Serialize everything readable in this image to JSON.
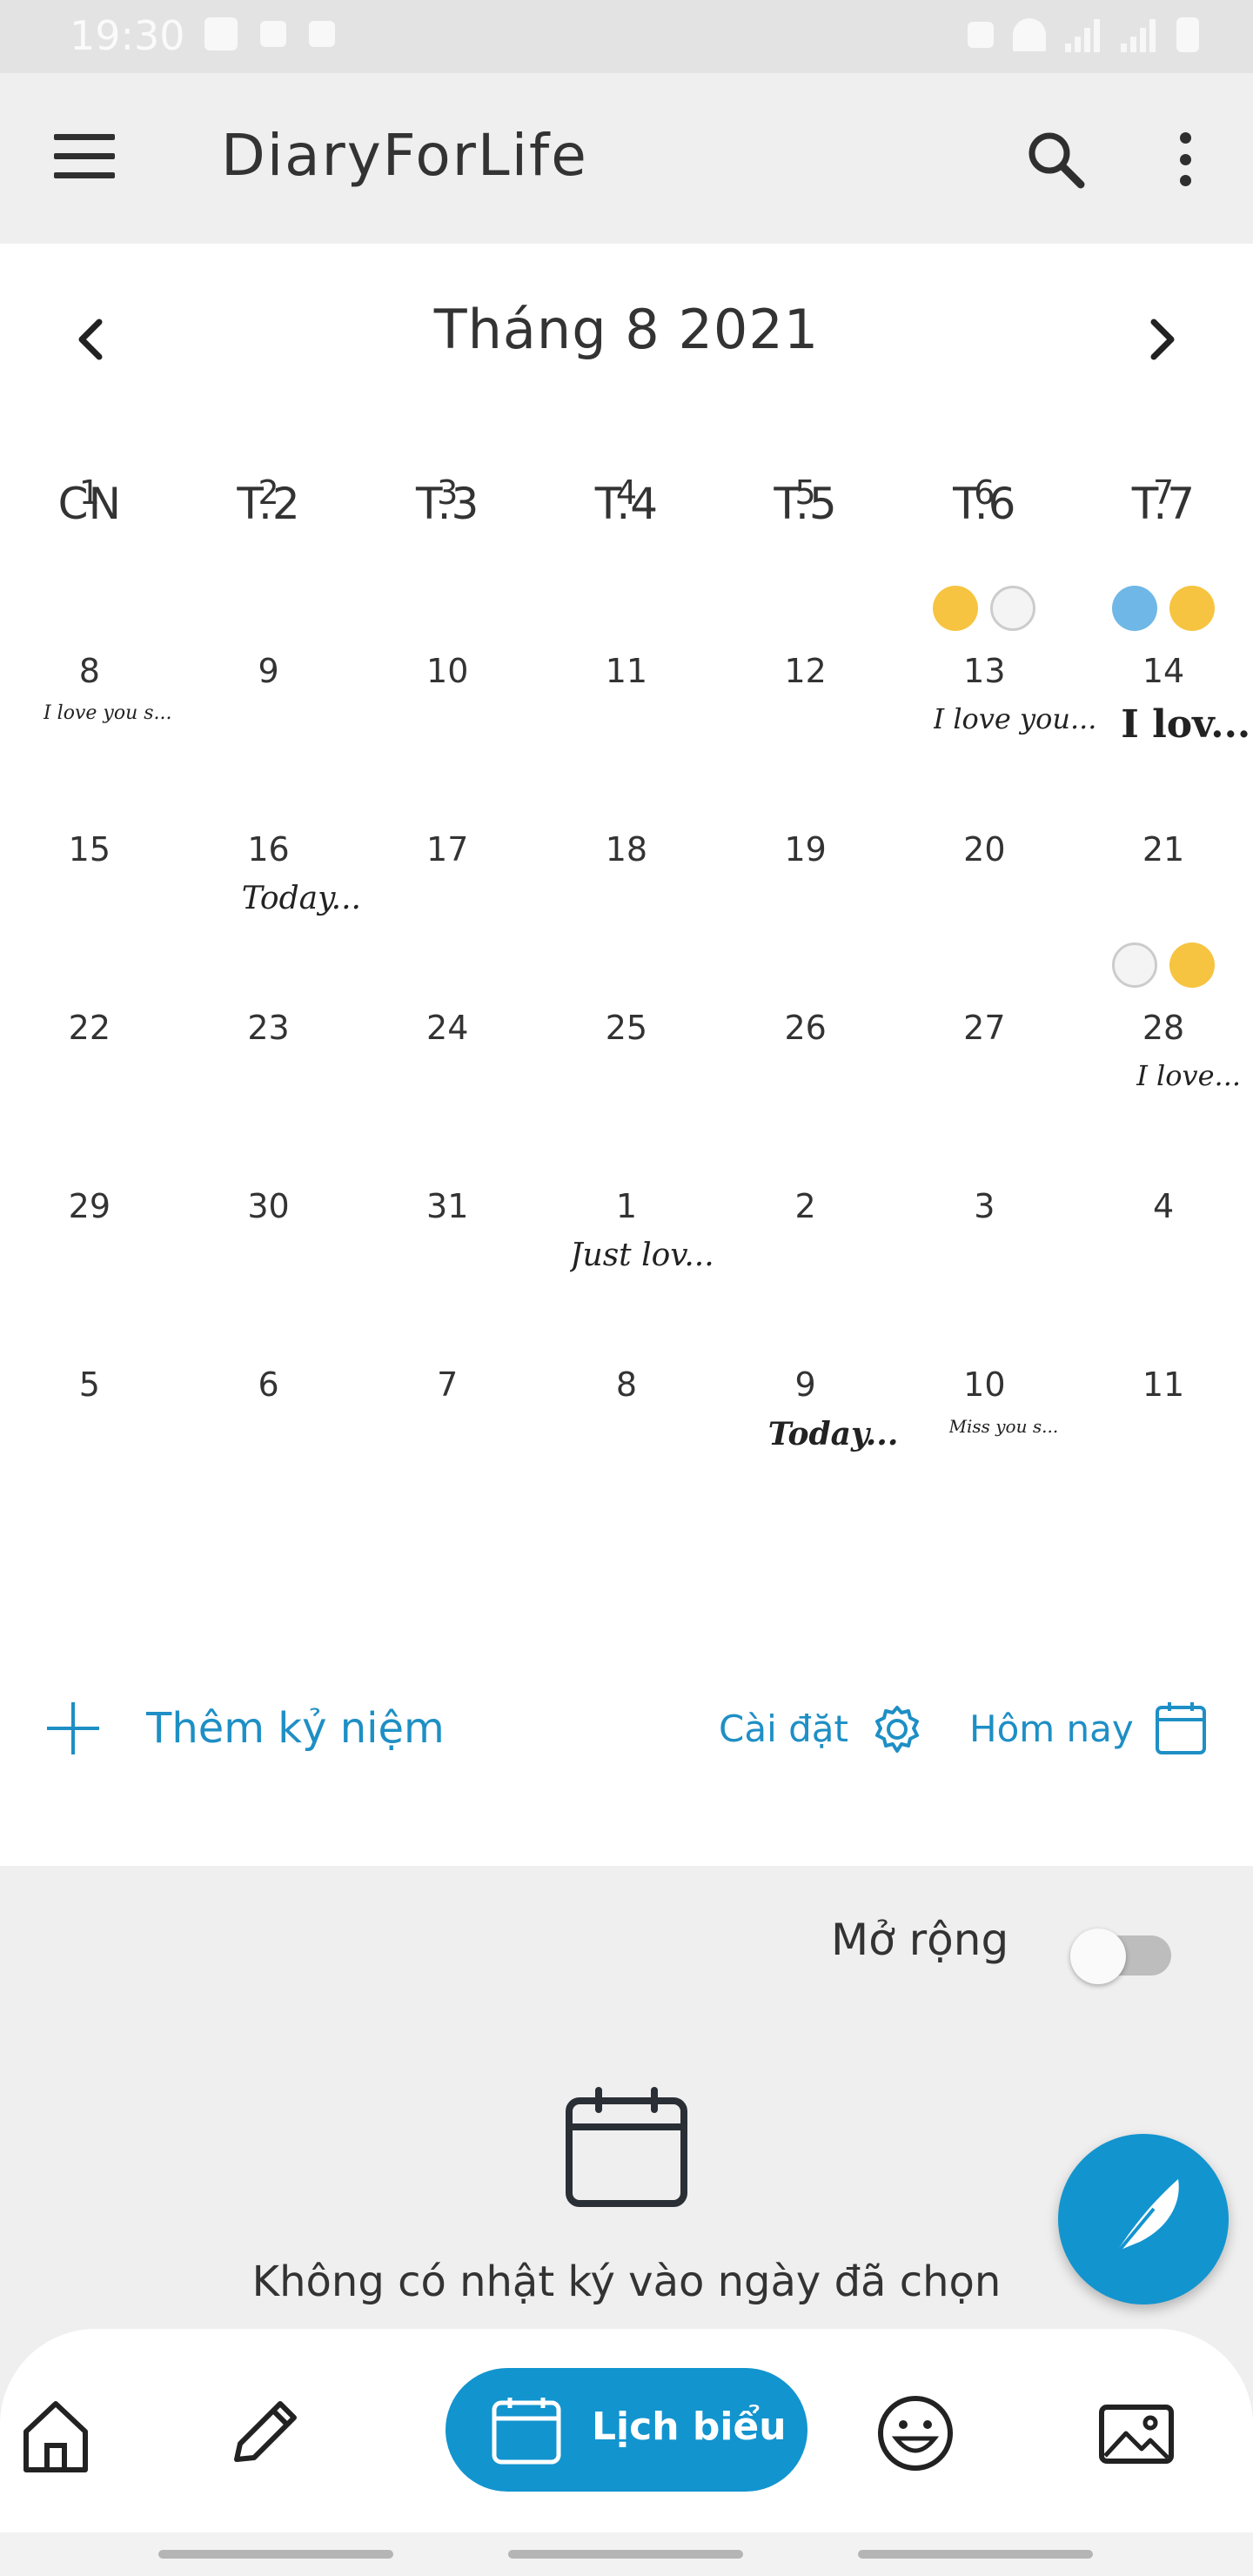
{
  "status_bar": {
    "time": "19:30"
  },
  "app_bar": {
    "title": "DiaryForLife"
  },
  "calendar": {
    "month_title": "Tháng 8 2021",
    "weekdays": [
      "CN",
      "T.2",
      "T.3",
      "T.4",
      "T.5",
      "T.6",
      "T.7"
    ],
    "days": [
      [
        "1",
        "2",
        "3",
        "4",
        "5",
        "6",
        "7"
      ],
      [
        "8",
        "9",
        "10",
        "11",
        "12",
        "13",
        "14"
      ],
      [
        "15",
        "16",
        "17",
        "18",
        "19",
        "20",
        "21"
      ],
      [
        "22",
        "23",
        "24",
        "25",
        "26",
        "27",
        "28"
      ],
      [
        "29",
        "30",
        "31",
        "1",
        "2",
        "3",
        "4"
      ],
      [
        "5",
        "6",
        "7",
        "8",
        "9",
        "10",
        "11"
      ]
    ],
    "notes": {
      "d8": "I love you s...",
      "d13": "I love you...",
      "d14": "I lov...",
      "d16": "Today...",
      "d28": "I love...",
      "s1": "Just lov...",
      "s9": "Today...",
      "s10": "Miss you s..."
    },
    "emoji_icons": {
      "d13": [
        "kissing-face-icon",
        "ghost-icon"
      ],
      "d14": [
        "whale-icon",
        "heart-eyes-icon"
      ],
      "d28": [
        "ghost-icon",
        "sleeping-face-icon"
      ]
    }
  },
  "actions": {
    "add_label": "Thêm kỷ niệm",
    "settings_label": "Cài đặt",
    "today_label": "Hôm nay"
  },
  "expand": {
    "label": "Mở rộng",
    "enabled": false
  },
  "empty_state": {
    "text": "Không có nhật ký vào ngày đã chọn"
  },
  "bottom_nav": {
    "active_label": "Lịch biểu"
  },
  "colors": {
    "accent": "#1294cf",
    "link": "#1e8fc5",
    "background": "#efefef",
    "card": "#ffffff"
  }
}
